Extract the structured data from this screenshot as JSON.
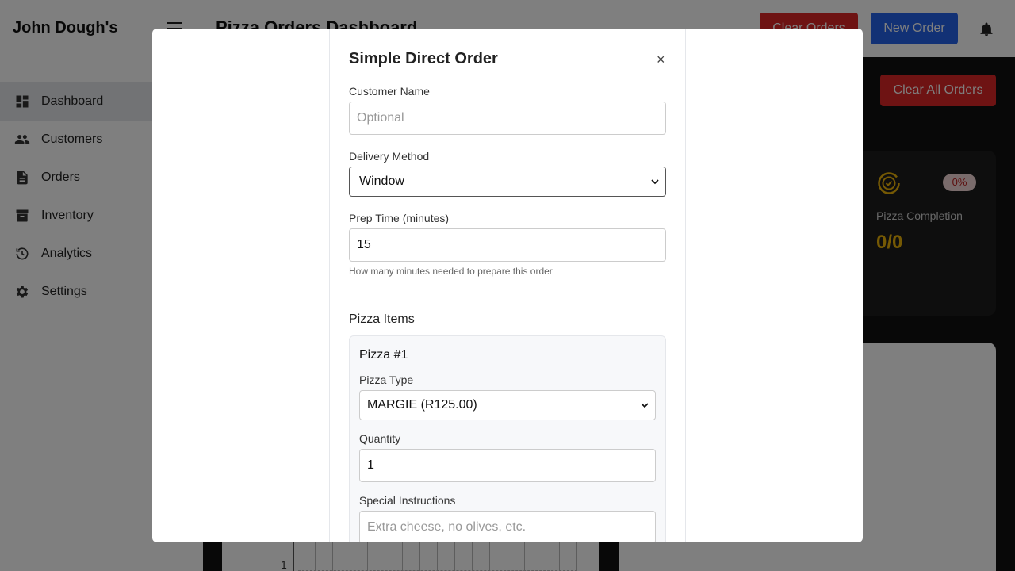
{
  "app": {
    "brand": "John Dough's",
    "page_title": "Pizza Orders Dashboard",
    "header_buttons": {
      "clear_orders": "Clear Orders",
      "new_order": "New Order"
    }
  },
  "sidebar": {
    "items": [
      {
        "label": "Dashboard",
        "icon": "dashboard-icon",
        "active": true
      },
      {
        "label": "Customers",
        "icon": "people-icon"
      },
      {
        "label": "Orders",
        "icon": "document-icon"
      },
      {
        "label": "Inventory",
        "icon": "archive-icon"
      },
      {
        "label": "Analytics",
        "icon": "history-icon"
      },
      {
        "label": "Settings",
        "icon": "gear-icon"
      }
    ]
  },
  "dashboard": {
    "clear_all_label": "Clear All Orders",
    "stat": {
      "badge": "0%",
      "label": "Pizza Completion",
      "value": "0/0"
    },
    "chart_tick": "1"
  },
  "modal": {
    "title": "Simple Direct Order",
    "close": "×",
    "customer_name": {
      "label": "Customer Name",
      "placeholder": "Optional"
    },
    "delivery_method": {
      "label": "Delivery Method",
      "value": "Window"
    },
    "prep_time": {
      "label": "Prep Time (minutes)",
      "value": "15",
      "hint": "How many minutes needed to prepare this order"
    },
    "section_title": "Pizza Items",
    "pizza": {
      "title": "Pizza #1",
      "type_label": "Pizza Type",
      "type_value": "MARGIE (R125.00)",
      "quantity_label": "Quantity",
      "quantity_value": "1",
      "instructions_label": "Special Instructions",
      "instructions_placeholder": "Extra cheese, no olives, etc."
    }
  },
  "colors": {
    "danger": "#dc2626",
    "primary": "#2563eb",
    "accent": "#eab308"
  }
}
